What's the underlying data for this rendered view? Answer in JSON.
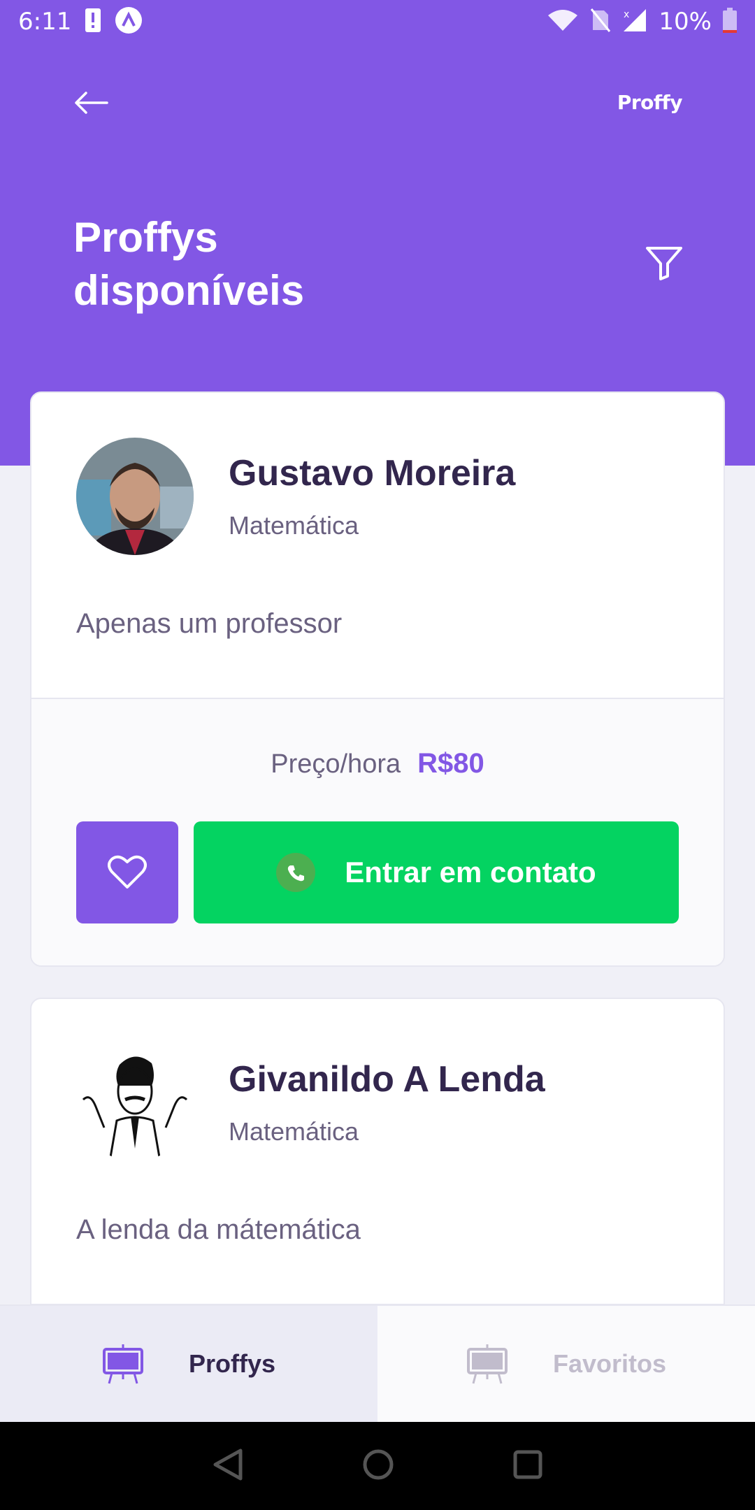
{
  "status_bar": {
    "time": "6:11",
    "battery_text": "10%"
  },
  "header": {
    "logo": "Proffy",
    "title_line1": "Proffys",
    "title_line2": "disponíveis",
    "icons": [
      "arrow-left-icon",
      "filter-icon"
    ]
  },
  "teachers": [
    {
      "name": "Gustavo Moreira",
      "subject": "Matemática",
      "bio": "Apenas um professor",
      "price_label": "Preço/hora",
      "price_value": "R$80",
      "contact_label": "Entrar em contato"
    },
    {
      "name": "Givanildo A Lenda",
      "subject": "Matemática",
      "bio": "A lenda da mátemática"
    }
  ],
  "tabs": [
    {
      "label": "Proffys",
      "active": true
    },
    {
      "label": "Favoritos",
      "active": false
    }
  ],
  "colors": {
    "primary": "#8257E5",
    "secondary": "#04D361",
    "title_text": "#32264D",
    "body_text": "#6A6180",
    "background": "#F0F0F7"
  }
}
